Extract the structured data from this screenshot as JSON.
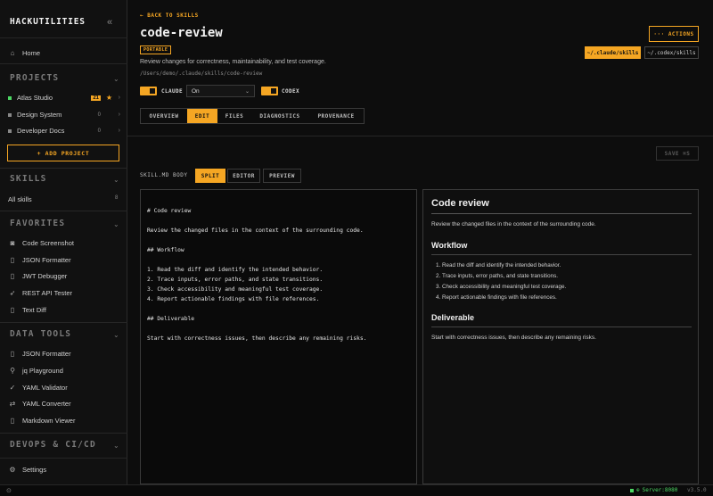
{
  "sidebar": {
    "brand": "HACKUTILITIES",
    "collapse_icon": "«",
    "home": "Home",
    "projects_title": "PROJECTS",
    "projects": [
      {
        "name": "Atlas Studio",
        "count": "21",
        "starred": true,
        "color": "#4cd964"
      },
      {
        "name": "Design System",
        "count": "0",
        "color": "#888888"
      },
      {
        "name": "Developer Docs",
        "count": "0",
        "color": "#888888"
      }
    ],
    "add_project": "+ ADD PROJECT",
    "skills_title": "SKILLS",
    "all_skills": "All skills",
    "all_skills_count": "8",
    "favorites_title": "FAVORITES",
    "favorites": [
      "Code Screenshot",
      "JSON Formatter",
      "JWT Debugger",
      "REST API Tester",
      "Text Diff"
    ],
    "data_tools_title": "DATA TOOLS",
    "data_tools": [
      "JSON Formatter",
      "jq Playground",
      "YAML Validator",
      "YAML Converter",
      "Markdown Viewer"
    ],
    "devops_title": "DEVOPS & CI/CD",
    "settings": "Settings"
  },
  "header": {
    "back": "← BACK TO SKILLS",
    "title": "code-review",
    "badge": "PORTABLE",
    "description": "Review changes for correctness, maintainability, and test coverage.",
    "path": "/Users/demo/.claude/skills/code-review",
    "actions": "··· ACTIONS",
    "chip_claude": "~/.claude/skills",
    "chip_codex": "~/.codex/skills",
    "claude_label": "CLAUDE",
    "select_value": "On",
    "codex_label": "CODEX"
  },
  "tabs": [
    "OVERVIEW",
    "EDIT",
    "FILES",
    "DIAGNOSTICS",
    "PROVENANCE"
  ],
  "active_tab": "EDIT",
  "editor": {
    "save_label": "SAVE ⌘S",
    "body_label": "SKILL.MD BODY",
    "view_modes": [
      "SPLIT",
      "EDITOR",
      "PREVIEW"
    ],
    "active_mode": "SPLIT",
    "content": "# Code review\n\nReview the changed files in the context of the surrounding code.\n\n## Workflow\n\n1. Read the diff and identify the intended behavior.\n2. Trace inputs, error paths, and state transitions.\n3. Check accessibility and meaningful test coverage.\n4. Report actionable findings with file references.\n\n## Deliverable\n\nStart with correctness issues, then describe any remaining risks."
  },
  "preview": {
    "h1": "Code review",
    "intro": "Review the changed files in the context of the surrounding code.",
    "h2_workflow": "Workflow",
    "steps": [
      "Read the diff and identify the intended behavior.",
      "Trace inputs, error paths, and state transitions.",
      "Check accessibility and meaningful test coverage.",
      "Report actionable findings with file references."
    ],
    "h2_deliverable": "Deliverable",
    "deliverable": "Start with correctness issues, then describe any remaining risks."
  },
  "statusbar": {
    "server": "Server:8080",
    "version": "v3.5.0"
  },
  "colors": {
    "accent": "#f5a623",
    "ok": "#4cd964"
  }
}
